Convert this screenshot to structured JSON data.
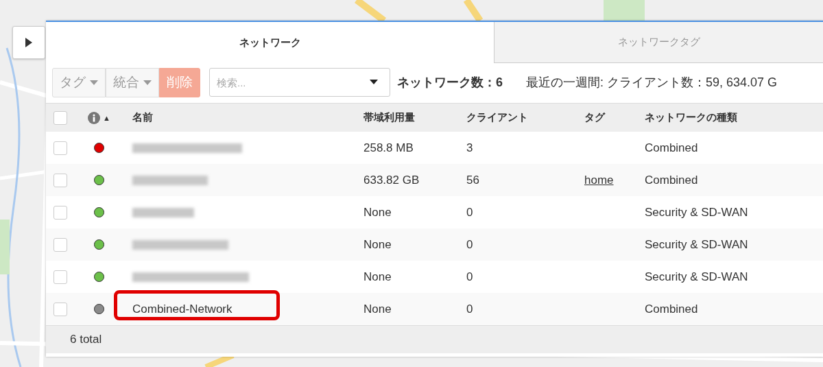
{
  "tabs": [
    {
      "label": "ネットワーク",
      "selected": true
    },
    {
      "label": "ネットワークタグ",
      "selected": false
    }
  ],
  "toolbar": {
    "buttons": [
      {
        "label": "タグ",
        "kind": "dropdown"
      },
      {
        "label": "統合",
        "kind": "dropdown"
      },
      {
        "label": "削除",
        "kind": "danger"
      }
    ],
    "search": {
      "placeholder": "検索..."
    },
    "network_count": "ネットワーク数：6",
    "summary": "最近の一週間: クライアント数：59, 634.07 G"
  },
  "table": {
    "header_checked": false,
    "sort_indicator": "▲",
    "columns": [
      "名前",
      "帯域利用量",
      "クライアント",
      "タグ",
      "ネットワークの種類"
    ],
    "rows": [
      {
        "checked": false,
        "color": "#e00000",
        "kind": "blurred",
        "bandwidth": "258.8 MB",
        "clients": "3",
        "type": "Combined"
      },
      {
        "checked": false,
        "color": "#6cc04a",
        "kind": "blurred",
        "bandwidth": "633.82 GB",
        "clients": "56",
        "tag": "home",
        "type": "Combined"
      },
      {
        "checked": false,
        "color": "#6cc04a",
        "kind": "blurred",
        "bandwidth": "None",
        "clients": "0",
        "type": "Security & SD-WAN"
      },
      {
        "checked": false,
        "color": "#6cc04a",
        "kind": "blurred",
        "bandwidth": "None",
        "clients": "0",
        "type": "Security & SD-WAN"
      },
      {
        "checked": false,
        "color": "#6cc04a",
        "kind": "blurred",
        "bandwidth": "None",
        "clients": "0",
        "type": "Security & SD-WAN"
      },
      {
        "checked": false,
        "color": "#8a8a8a",
        "kind": "text",
        "name": "Combined-Network",
        "highlighted": true,
        "bandwidth": "None",
        "clients": "0",
        "type": "Combined"
      }
    ],
    "footer": "6 total"
  }
}
